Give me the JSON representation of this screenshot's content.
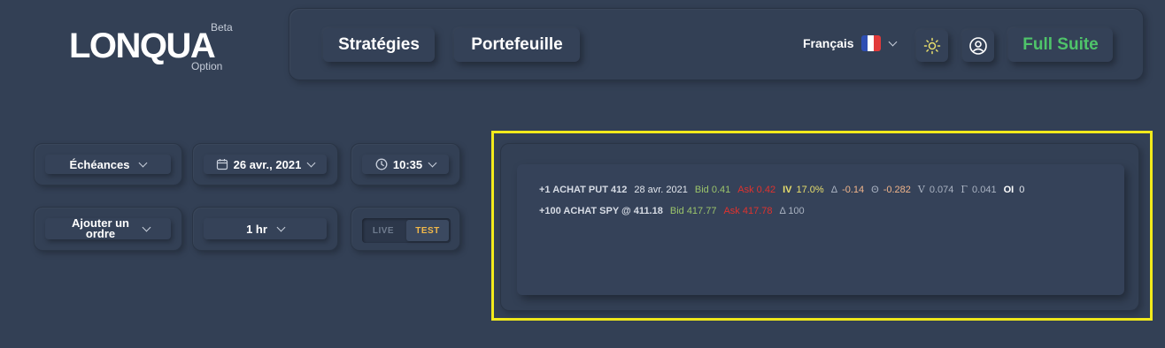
{
  "logo": {
    "name": "LONQUA",
    "beta": "Beta",
    "subtitle": "Option"
  },
  "nav": {
    "strategies": "Stratégies",
    "portfolio": "Portefeuille",
    "language": "Français",
    "full_suite": "Full Suite"
  },
  "colors": {
    "background": "#334055",
    "accent_green": "#4fc46a",
    "test_orange": "#f2b94a",
    "bid_green": "#9bc46b",
    "ask_red": "#e0322e",
    "highlight": "#f2ea1c"
  },
  "controls": {
    "expirations": "Échéances",
    "date": "26 avr., 2021",
    "time": "10:35",
    "add_order": "Ajouter un ordre",
    "interval": "1 hr",
    "live": "LIVE",
    "test": "TEST"
  },
  "orders": [
    {
      "label": "+1 ACHAT PUT 412",
      "date": "28 avr. 2021",
      "bid": "Bid 0.41",
      "ask": "Ask 0.42",
      "iv_label": "IV",
      "iv": "17.0%",
      "delta_sym": "Δ",
      "delta": "-0.14",
      "theta_sym": "Θ",
      "theta": "-0.282",
      "vega_sym": "V",
      "vega": "0.074",
      "gamma_sym": "Γ",
      "gamma": "0.041",
      "oi_label": "OI",
      "oi": "0"
    },
    {
      "label": "+100 ACHAT SPY @ 411.18",
      "bid": "Bid 417.77",
      "ask": "Ask 417.78",
      "delta": "Δ 100"
    }
  ]
}
